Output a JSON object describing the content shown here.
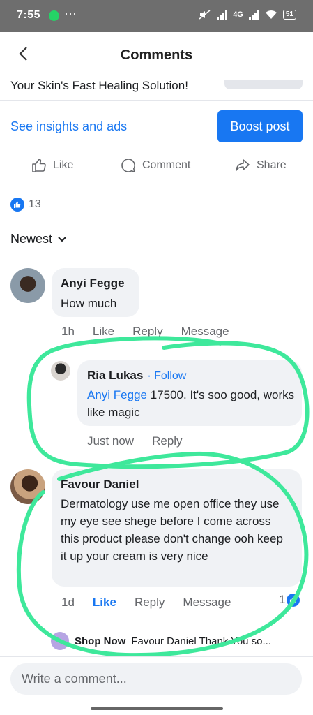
{
  "status_bar": {
    "time": "7:55",
    "battery": "51",
    "network": "4G",
    "dots": "···"
  },
  "header": {
    "title": "Comments"
  },
  "post": {
    "snippet": "Your Skin's Fast Healing Solution!"
  },
  "promo": {
    "insights_label": "See insights and ads",
    "boost_label": "Boost post"
  },
  "actions": {
    "like": "Like",
    "comment": "Comment",
    "share": "Share"
  },
  "reactions": {
    "count": "13"
  },
  "sort": {
    "label": "Newest"
  },
  "comments": [
    {
      "name": "Anyi Fegge",
      "text": "How much",
      "time": "1h",
      "like": "Like",
      "reply": "Reply",
      "message": "Message",
      "replies": [
        {
          "name": "Ria Lukas",
          "follow": "· Follow",
          "mention": "Anyi Fegge",
          "text": " 17500. It's soo good, works like magic",
          "time": "Just now",
          "reply": "Reply"
        }
      ]
    },
    {
      "name": "Favour Daniel",
      "text": "Dermatology use me open office they use my eye see shege before I come across this product please don't change ooh keep it up your cream is very nice",
      "time": "1d",
      "like": "Like",
      "reply": "Reply",
      "message": "Message",
      "like_count": "1",
      "reply_preview": {
        "name": "Shop Now",
        "text": "Favour Daniel Thank You so..."
      }
    }
  ],
  "composer": {
    "placeholder": "Write a comment..."
  },
  "colors": {
    "accent": "#1877f2",
    "annotation": "#3ee89b"
  }
}
